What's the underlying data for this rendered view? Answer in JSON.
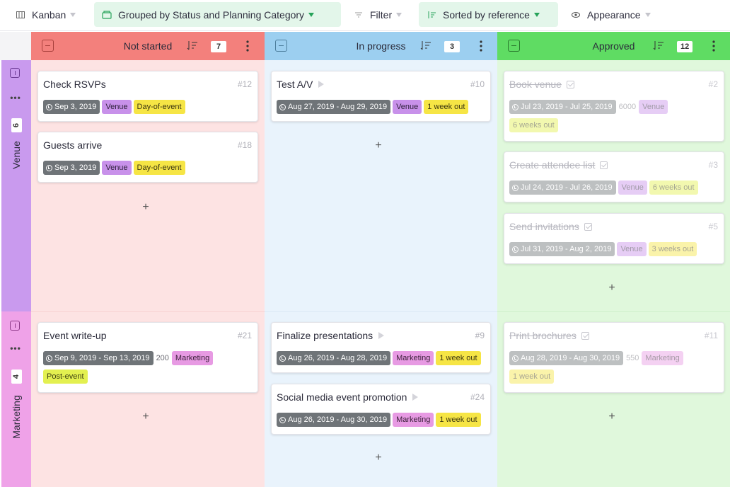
{
  "toolbar": {
    "view": "Kanban",
    "group": "Grouped by Status and Planning Category",
    "filter": "Filter",
    "sort": "Sorted by reference",
    "appearance": "Appearance"
  },
  "columns": [
    {
      "title": "Not started",
      "count": "7"
    },
    {
      "title": "In progress",
      "count": "3"
    },
    {
      "title": "Approved",
      "count": "12"
    }
  ],
  "groups": [
    {
      "name": "Venue",
      "count": "6"
    },
    {
      "name": "Marketing",
      "count": "4"
    }
  ],
  "add_label": "+",
  "cards": {
    "venue_not_started": [
      {
        "title": "Check RSVPs",
        "ref": "#12",
        "date": "Sep 3, 2019",
        "category": "Venue",
        "timing": "Day-of-event"
      },
      {
        "title": "Guests arrive",
        "ref": "#18",
        "date": "Sep 3, 2019",
        "category": "Venue",
        "timing": "Day-of-event"
      }
    ],
    "venue_in_progress": [
      {
        "title": "Test A/V",
        "ref": "#10",
        "date": "Aug 27, 2019 - Aug 29, 2019",
        "category": "Venue",
        "timing": "1 week out"
      }
    ],
    "venue_approved": [
      {
        "title": "Book venue",
        "ref": "#2",
        "date": "Jul 23, 2019 - Jul 25, 2019",
        "budget": "6000",
        "category": "Venue",
        "timing": "6 weeks out"
      },
      {
        "title": "Create attendee list",
        "ref": "#3",
        "date": "Jul 24, 2019 - Jul 26, 2019",
        "category": "Venue",
        "timing": "6 weeks out"
      },
      {
        "title": "Send invitations",
        "ref": "#5",
        "date": "Jul 31, 2019 - Aug 2, 2019",
        "category": "Venue",
        "timing": "3 weeks out"
      }
    ],
    "marketing_not_started": [
      {
        "title": "Event write-up",
        "ref": "#21",
        "date": "Sep 9, 2019 - Sep 13, 2019",
        "budget": "200",
        "category": "Marketing",
        "timing": "Post-event"
      }
    ],
    "marketing_in_progress": [
      {
        "title": "Finalize presentations",
        "ref": "#9",
        "date": "Aug 26, 2019 - Aug 28, 2019",
        "category": "Marketing",
        "timing": "1 week out"
      },
      {
        "title": "Social media event promotion",
        "ref": "#24",
        "date": "Aug 26, 2019 - Aug 30, 2019",
        "category": "Marketing",
        "timing": "1 week out"
      }
    ],
    "marketing_approved": [
      {
        "title": "Print brochures",
        "ref": "#11",
        "date": "Aug 28, 2019 - Aug 30, 2019",
        "budget": "550",
        "category": "Marketing",
        "timing": "1 week out"
      }
    ]
  },
  "colors": {
    "not_started_header": "#f3807c",
    "not_started_bg": "#fde3e3",
    "in_progress_header": "#9ccff0",
    "in_progress_bg": "#e9f3fc",
    "approved_header": "#5fdc63",
    "approved_bg": "#e0f8dc",
    "venue_group": "#c99aee",
    "marketing_group": "#efa2e8",
    "toolbar_active": "#e3f6ea"
  }
}
